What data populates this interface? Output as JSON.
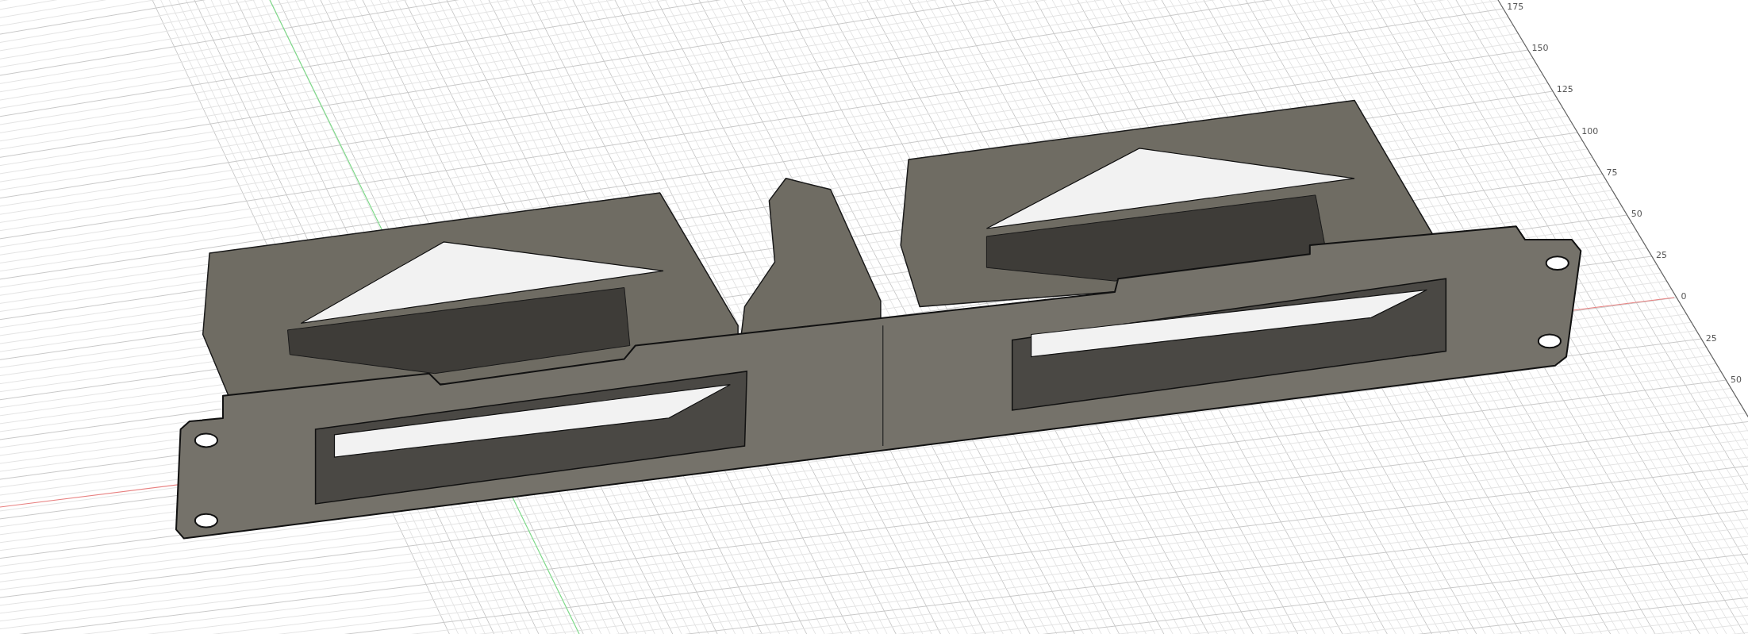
{
  "viewport": {
    "ruler_ticks": [
      {
        "label": "175"
      },
      {
        "label": "150"
      },
      {
        "label": "125"
      },
      {
        "label": "100"
      },
      {
        "label": "75"
      },
      {
        "label": "50"
      },
      {
        "label": "25"
      },
      {
        "label": "0"
      },
      {
        "label": "25"
      },
      {
        "label": "50"
      }
    ]
  }
}
